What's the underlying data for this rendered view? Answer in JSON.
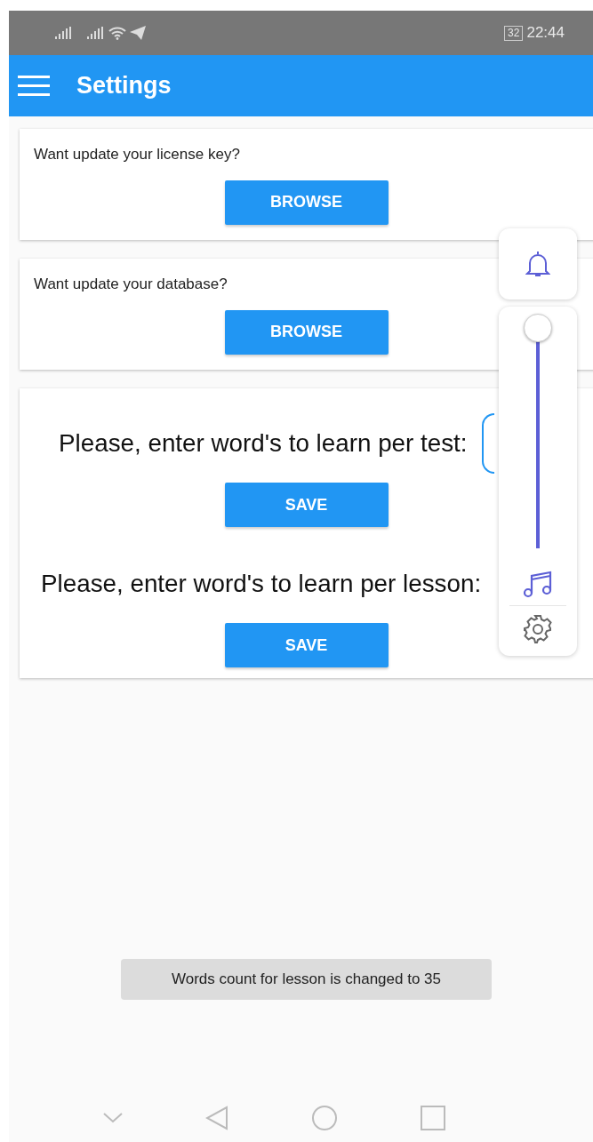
{
  "status_bar": {
    "battery": "32",
    "time": "22:44"
  },
  "app_bar": {
    "title": "Settings"
  },
  "browse_cards": [
    {
      "prompt": "Want update your license key?",
      "button": "BROWSE"
    },
    {
      "prompt": "Want update your database?",
      "button": "BROWSE"
    }
  ],
  "word_settings": [
    {
      "prompt": "Please, enter word's to learn per test:",
      "has_field": true,
      "button": "SAVE"
    },
    {
      "prompt": "Please, enter word's to learn per lesson:",
      "has_field": false,
      "button": "SAVE"
    }
  ],
  "toast": "Words count for lesson is changed to 35"
}
